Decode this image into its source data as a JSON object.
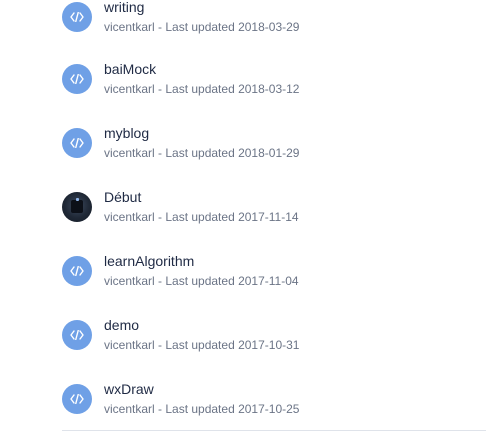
{
  "repos": [
    {
      "name": "writing",
      "author": "vicentkarl",
      "updated_prefix": "Last updated",
      "date": "2018-03-29",
      "icon": "code-icon",
      "meta": "vicentkarl - Last updated 2018-03-29"
    },
    {
      "name": "baiMock",
      "author": "vicentkarl",
      "updated_prefix": "Last updated",
      "date": "2018-03-12",
      "icon": "code-icon",
      "meta": "vicentkarl - Last updated 2018-03-12"
    },
    {
      "name": "myblog",
      "author": "vicentkarl",
      "updated_prefix": "Last updated",
      "date": "2018-01-29",
      "icon": "code-icon",
      "meta": "vicentkarl - Last updated 2018-01-29"
    },
    {
      "name": "Début",
      "author": "vicentkarl",
      "updated_prefix": "Last updated",
      "date": "2017-11-14",
      "icon": "avatar-image",
      "meta": "vicentkarl - Last updated 2017-11-14"
    },
    {
      "name": "learnAlgorithm",
      "author": "vicentkarl",
      "updated_prefix": "Last updated",
      "date": "2017-11-04",
      "icon": "code-icon",
      "meta": "vicentkarl - Last updated 2017-11-04"
    },
    {
      "name": "demo",
      "author": "vicentkarl",
      "updated_prefix": "Last updated",
      "date": "2017-10-31",
      "icon": "code-icon",
      "meta": "vicentkarl - Last updated 2017-10-31"
    },
    {
      "name": "wxDraw",
      "author": "vicentkarl",
      "updated_prefix": "Last updated",
      "date": "2017-10-25",
      "icon": "code-icon",
      "meta": "vicentkarl - Last updated 2017-10-25"
    }
  ],
  "colors": {
    "icon_bg": "#6fa0e6",
    "name_text": "#1f2a44",
    "meta_text": "#6b7486",
    "divider": "#dfe3ea"
  }
}
